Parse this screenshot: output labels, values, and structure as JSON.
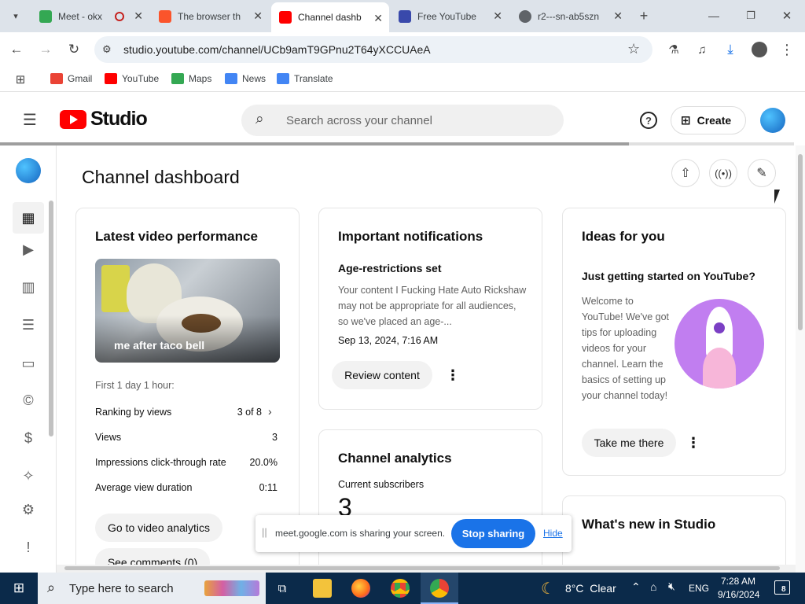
{
  "browser": {
    "tabs": [
      {
        "title": "Meet - okx",
        "active": false
      },
      {
        "title": "The browser th",
        "active": false
      },
      {
        "title": "Channel dashb",
        "active": true
      },
      {
        "title": "Free YouTube",
        "active": false
      },
      {
        "title": "r2---sn-ab5szn",
        "active": false
      }
    ],
    "url": "studio.youtube.com/channel/UCb9amT9GPnu2T64yXCCUAeA",
    "bookmarks": [
      "Gmail",
      "YouTube",
      "Maps",
      "News",
      "Translate"
    ]
  },
  "header": {
    "logo_text": "Studio",
    "search_placeholder": "Search across your channel",
    "create_label": "Create"
  },
  "page": {
    "title": "Channel dashboard"
  },
  "latest_video": {
    "heading": "Latest video performance",
    "thumb_caption": "me after taco bell",
    "period": "First 1 day 1 hour:",
    "metrics": [
      {
        "label": "Ranking by views",
        "value": "3 of 8"
      },
      {
        "label": "Views",
        "value": "3"
      },
      {
        "label": "Impressions click-through rate",
        "value": "20.0%"
      },
      {
        "label": "Average view duration",
        "value": "0:11"
      }
    ],
    "analytics_button": "Go to video analytics",
    "comments_button": "See comments (0)"
  },
  "notifications": {
    "heading": "Important notifications",
    "item_title": "Age-restrictions set",
    "item_body": "Your content I Fucking Hate Auto Rickshaw may not be appropriate for all audiences, so we've placed an age-...",
    "item_date": "Sep 13, 2024, 7:16 AM",
    "review_button": "Review content"
  },
  "analytics": {
    "heading": "Channel analytics",
    "subscribers_label": "Current subscribers",
    "subscribers_value": "3"
  },
  "ideas": {
    "heading": "Ideas for you",
    "subheading": "Just getting started on YouTube?",
    "body": "Welcome to YouTube! We've got tips for uploading videos for your channel. Learn the basics of setting up your channel today!",
    "button": "Take me there"
  },
  "whats_new": {
    "heading": "What's new in Studio"
  },
  "sharebar": {
    "message": "meet.google.com is sharing your screen.",
    "stop_label": "Stop sharing",
    "hide_label": "Hide"
  },
  "taskbar": {
    "search_placeholder": "Type here to search",
    "weather": "8°C  Clear",
    "lang": "ENG",
    "time": "7:28 AM",
    "date": "9/16/2024",
    "notif_count": "8"
  },
  "colors": {
    "youtube_red": "#ff0000",
    "stop_blue": "#1a73e8",
    "rocket_purple": "#c17ef0",
    "taskbar": "#0b2a4a"
  }
}
